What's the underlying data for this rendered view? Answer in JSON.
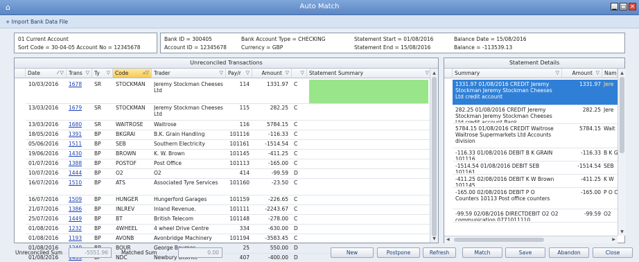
{
  "window": {
    "title": "Auto Match"
  },
  "import_link": "+ Import Bank Data File",
  "account": {
    "name": "01 Current Account",
    "sort_line": "Sort Code = 30-04-05 Account No = 12345678",
    "bank_id": "Bank ID = 300405",
    "account_id": "Account ID = 12345678",
    "type": "Bank Account Type = CHECKING",
    "currency": "Currency = GBP",
    "stmt_start": "Statement Start = 01/08/2016",
    "stmt_end": "Statement End  = 15/08/2016",
    "balance_date": "Balance Date = 15/08/2016",
    "balance": "Balance = -113539.13"
  },
  "unreconciled": {
    "title": "Unreconciled Transactions",
    "columns": {
      "date": "Date",
      "trans": "Trans",
      "type": "Ty",
      "code": "Code",
      "trader": "Trader",
      "payr": "Pay/r",
      "amount": "Amount",
      "dc": "",
      "summary": "Statement Summary"
    },
    "rows": [
      {
        "date": "10/03/2016",
        "trans": "1678",
        "type": "SR",
        "code": "STOCKMAN",
        "trader": "Jeremy Stockman Cheeses Ltd",
        "payr": "114",
        "amount": "1331.97",
        "dc": "C"
      },
      {
        "date": "13/03/2016",
        "trans": "1679",
        "type": "SR",
        "code": "STOCKMAN",
        "trader": "Jeremy Stockman Cheeses Ltd",
        "payr": "115",
        "amount": "282.25",
        "dc": "C"
      },
      {
        "date": "13/03/2016",
        "trans": "1680",
        "type": "SR",
        "code": "WAITROSE",
        "trader": "Waitrose",
        "payr": "116",
        "amount": "5784.15",
        "dc": "C"
      },
      {
        "date": "18/05/2016",
        "trans": "1391",
        "type": "BP",
        "code": "BKGRAI",
        "trader": "B.K. Grain Handling",
        "payr": "101116",
        "amount": "-116.33",
        "dc": "C"
      },
      {
        "date": "05/06/2016",
        "trans": "1511",
        "type": "BP",
        "code": "SEB",
        "trader": "Southern Electricity",
        "payr": "101161",
        "amount": "-1514.54",
        "dc": "C"
      },
      {
        "date": "19/06/2016",
        "trans": "1430",
        "type": "BP",
        "code": "BROWN",
        "trader": "K. W. Brown",
        "payr": "101145",
        "amount": "-411.25",
        "dc": "C"
      },
      {
        "date": "01/07/2016",
        "trans": "1388",
        "type": "BP",
        "code": "POSTOF",
        "trader": "Post Office",
        "payr": "101113",
        "amount": "-165.00",
        "dc": "C"
      },
      {
        "date": "10/07/2016",
        "trans": "1444",
        "type": "BP",
        "code": "O2",
        "trader": "O2",
        "payr": "414",
        "amount": "-99.59",
        "dc": "D"
      },
      {
        "date": "16/07/2016",
        "trans": "1510",
        "type": "BP",
        "code": "ATS",
        "trader": "Associated Tyre Services",
        "payr": "101160",
        "amount": "-23.50",
        "dc": "C"
      },
      {
        "date": "16/07/2016",
        "trans": "1509",
        "type": "BP",
        "code": "HUNGER",
        "trader": "Hungerford Garages",
        "payr": "101159",
        "amount": "-226.65",
        "dc": "C"
      },
      {
        "date": "21/07/2016",
        "trans": "1386",
        "type": "BP",
        "code": "INLREV",
        "trader": "Inland Revenue.",
        "payr": "101111",
        "amount": "-2243.67",
        "dc": "C"
      },
      {
        "date": "25/07/2016",
        "trans": "1449",
        "type": "BP",
        "code": "BT",
        "trader": "British Telecom",
        "payr": "101148",
        "amount": "-278.00",
        "dc": "C"
      },
      {
        "date": "01/08/2016",
        "trans": "1232",
        "type": "BP",
        "code": "4WHEEL",
        "trader": "4 wheel Drive Centre",
        "payr": "334",
        "amount": "-630.00",
        "dc": "D"
      },
      {
        "date": "01/08/2016",
        "trans": "1193",
        "type": "BP",
        "code": "AVONB",
        "trader": "Avonbridge Machinery",
        "payr": "101194",
        "amount": "-3583.45",
        "dc": "C"
      },
      {
        "date": "01/08/2016",
        "trans": "1240",
        "type": "BR",
        "code": "BOUR",
        "trader": "George Bournes",
        "payr": "25",
        "amount": "550.00",
        "dc": "D"
      },
      {
        "date": "01/08/2016",
        "trans": "1435",
        "type": "BP",
        "code": "NDC",
        "trader": "Newbury District",
        "payr": "407",
        "amount": "-400.00",
        "dc": "D"
      }
    ]
  },
  "statement": {
    "title": "Statement Details",
    "columns": {
      "summary": "Summary",
      "amount": "Amount",
      "name": "Nam"
    },
    "rows": [
      {
        "summary": "1331.97 01/08/2016 CREDIT Jeremy Stockman Jeremy Stockman Cheeses Ltd credit account",
        "amount": "1331.97",
        "name": "Jere"
      },
      {
        "summary": "282.25 01/08/2016 CREDIT Jeremy Stockman Jeremy Stockman Cheeses Ltd credit account Bank",
        "amount": "282.25",
        "name": "Jere"
      },
      {
        "summary": "5784.15 01/08/2016 CREDIT Waitrose Waitrose Supermarkets Ltd Accounts division",
        "amount": "5784.15",
        "name": "Wait"
      },
      {
        "summary": "-116.33 01/08/2016 DEBIT B K GRAIN 101116",
        "amount": "-116.33",
        "name": "B K G"
      },
      {
        "summary": "-1514.54 01/08/2016 DEBIT SEB 101161",
        "amount": "-1514.54",
        "name": "SEB"
      },
      {
        "summary": "-411.25 02/08/2016 DEBIT K W Brown 101145",
        "amount": "-411.25",
        "name": "K W"
      },
      {
        "summary": "-165.00 02/08/2016 DEBIT P O Counters 10113 Post office counters",
        "amount": "-165.00",
        "name": "P O C"
      },
      {
        "summary": "-99.59 02/08/2016 DIRECTDEBIT O2 O2 communication 0771011110",
        "amount": "-99.59",
        "name": "O2"
      }
    ]
  },
  "footer": {
    "unreconciled_label": "Unreconciled Sum",
    "unreconciled_value": "-5551.96",
    "matched_label": "Matched Sum",
    "matched_value": "0.00",
    "buttons": [
      "New",
      "Postpone",
      "Refresh",
      "Match",
      "Save",
      "Abandon",
      "Close"
    ]
  },
  "colors": {
    "title_bar": "#5c86c4",
    "match_highlight": "#98e58a",
    "selection": "#2f7fd6"
  }
}
